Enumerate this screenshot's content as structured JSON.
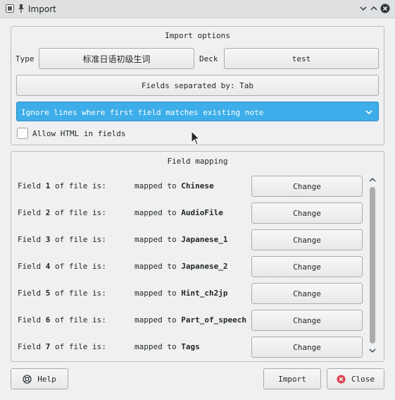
{
  "window": {
    "title": "Import",
    "icons": [
      "app-icon",
      "pin-icon",
      "minimize-icon",
      "maximize-icon",
      "close-icon"
    ]
  },
  "import_options": {
    "title": "Import options",
    "type_label": "Type",
    "type_value": "标准日语初级生词",
    "deck_label": "Deck",
    "deck_value": "test",
    "separator_button": "Fields separated by: Tab",
    "duplicate_mode": "Ignore lines where first field matches existing note",
    "allow_html_label": "Allow HTML in fields",
    "allow_html_checked": false
  },
  "field_mapping": {
    "title": "Field mapping",
    "rows": [
      {
        "prefix": "Field ",
        "num": "1",
        "suffix": " of file is:",
        "mapped": "mapped to ",
        "target": "Chinese",
        "button": "Change"
      },
      {
        "prefix": "Field ",
        "num": "2",
        "suffix": " of file is:",
        "mapped": "mapped to ",
        "target": "AudioFile",
        "button": "Change"
      },
      {
        "prefix": "Field ",
        "num": "3",
        "suffix": " of file is:",
        "mapped": "mapped to ",
        "target": "Japanese_1",
        "button": "Change"
      },
      {
        "prefix": "Field ",
        "num": "4",
        "suffix": " of file is:",
        "mapped": "mapped to ",
        "target": "Japanese_2",
        "button": "Change"
      },
      {
        "prefix": "Field ",
        "num": "5",
        "suffix": " of file is:",
        "mapped": "mapped to ",
        "target": "Hint_ch2jp",
        "button": "Change"
      },
      {
        "prefix": "Field ",
        "num": "6",
        "suffix": " of file is:",
        "mapped": "mapped to ",
        "target": "Part_of_speech",
        "button": "Change"
      },
      {
        "prefix": "Field ",
        "num": "7",
        "suffix": " of file is:",
        "mapped": "mapped to ",
        "target": "Tags",
        "button": "Change"
      }
    ]
  },
  "footer": {
    "help_label": "Help",
    "import_label": "Import",
    "close_label": "Close"
  },
  "colors": {
    "accent": "#3daee9",
    "close_icon": "#da4453",
    "window_bg": "#eff0f1"
  }
}
